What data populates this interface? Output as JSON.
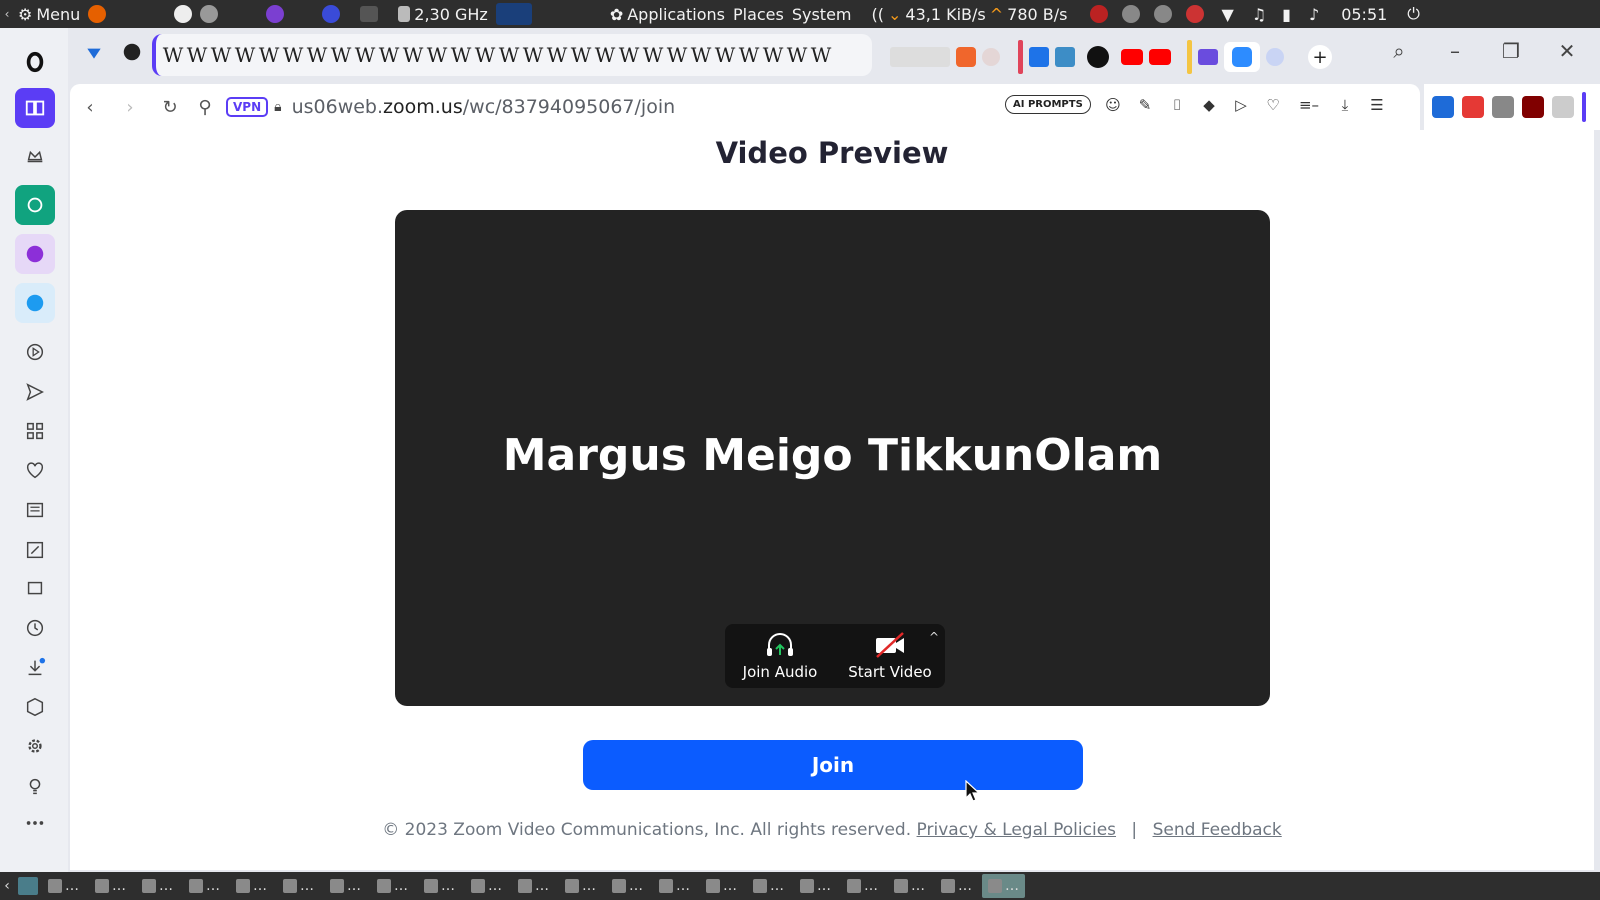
{
  "system_panel": {
    "menu_label": "Menu",
    "cpu_freq": "2,30 GHz",
    "applications_label": "Applications",
    "places_label": "Places",
    "system_label": "System",
    "net_down": "43,1 KiB/s",
    "net_up": "780 B/s",
    "clock": "05:51"
  },
  "browser": {
    "url_host_prefix": "us06web.",
    "url_host_main": "zoom.us",
    "url_path": "/wc/83794095067/join",
    "vpn_label": "VPN",
    "ai_prompts_label": "AI PROMPTS",
    "tab_strip_glyphs": [
      "W",
      "W",
      "W",
      "W",
      "W",
      "W",
      "W",
      "W",
      "W",
      "W",
      "W",
      "W",
      "W",
      "W",
      "W",
      "W",
      "W",
      "W",
      "W",
      "W",
      "W",
      "W",
      "W",
      "W",
      "W",
      "W",
      "W",
      "W"
    ]
  },
  "page": {
    "title": "Video Preview",
    "participant_name": "Margus Meigo TikkunOlam",
    "join_audio_label": "Join Audio",
    "start_video_label": "Start Video",
    "join_button_label": "Join",
    "footer_copyright": "© 2023 Zoom Video Communications, Inc. All rights reserved.",
    "privacy_link": "Privacy & Legal Policies",
    "separator": "|",
    "feedback_link": "Send Feedback"
  },
  "taskbar": {
    "items": [
      "…",
      "…",
      "…",
      "…",
      "…",
      "…",
      "…",
      "…",
      "…",
      "…",
      "…",
      "…",
      "…",
      "…",
      "…",
      "…",
      "…",
      "…",
      "…",
      "…",
      "…"
    ]
  },
  "colors": {
    "accent_purple": "#5b3df5",
    "zoom_blue": "#0b5cff",
    "preview_bg": "#232323"
  }
}
